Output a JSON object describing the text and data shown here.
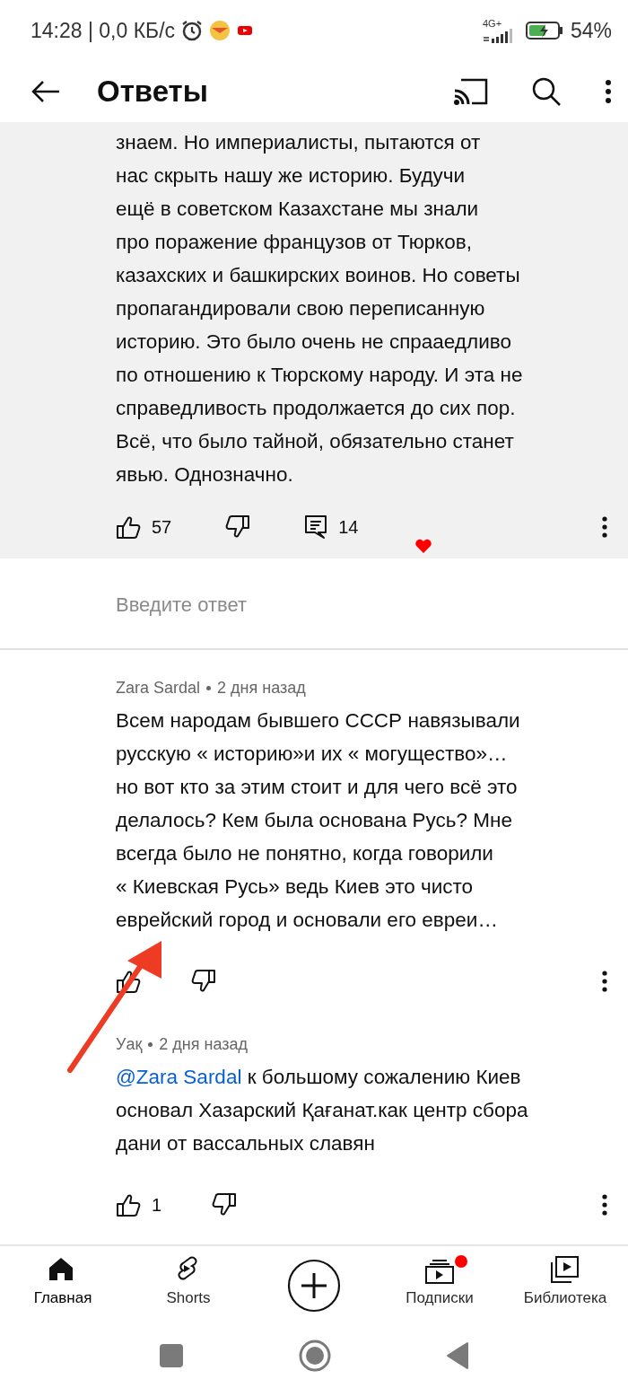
{
  "status_bar": {
    "time": "14:28 | 0,0 КБ/с",
    "network": "4G+",
    "battery": "54%",
    "charging": true
  },
  "header": {
    "title": "Ответы"
  },
  "parent_comment": {
    "body": "знаем. Но империалисты, пытаются от\nнас скрыть нашу же историю. Будучи\nещё в советском Казахстане мы знали\nпро поражение французов от Тюрков,\nказахских и башкирских воинов. Но советы\nпропагандировали свою переписанную\nисторию. Это было очень не спрааедливо\nпо отношению к Тюрскому народу. И эта не\nсправедливость продолжается до сих пор.\nВсё, что было тайной, обязательно станет\nявью. Однозначно.",
    "likes": "57",
    "replies": "14",
    "hearted": true
  },
  "reply_field": {
    "placeholder": "Введите ответ"
  },
  "replies": [
    {
      "author": "Zara Sardal",
      "time": "2 дня назад",
      "body": "Всем народам бывшего СССР навязывали\nрусскую « историю»и их « могущество»…\nно вот кто за этим стоит и для чего всё это\nделалось? Кем была основана Русь? Мне\nвсегда было не понятно, когда говорили\n« Киевская Русь» ведь Киев это чисто\nеврейский город и основали его евреи…"
    },
    {
      "author": "Уақ",
      "time": "2 дня назад",
      "mention": "@Zara Sardal",
      "body": " к большому сожалению Киев\nосновал Хазарский Қағанат.как центр сбора\nдани от вассальных славян",
      "likes": "1"
    }
  ],
  "bottom_nav": [
    {
      "label": "Главная",
      "kind": "home",
      "selected": true
    },
    {
      "label": "Shorts",
      "kind": "shorts",
      "selected": false
    },
    {
      "kind": "create"
    },
    {
      "label": "Подписки",
      "kind": "subscriptions",
      "selected": false,
      "badge": true
    },
    {
      "label": "Библиотека",
      "kind": "library",
      "selected": false
    }
  ]
}
